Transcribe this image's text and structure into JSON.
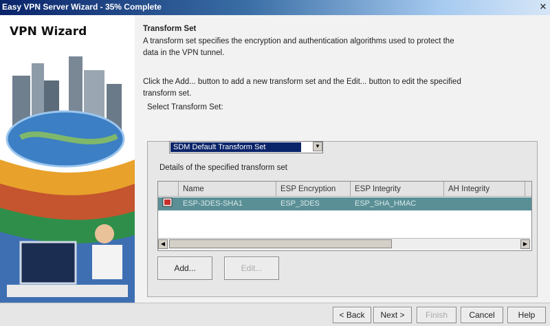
{
  "window": {
    "title": "Easy VPN Server Wizard - 35% Complete",
    "progress_percent": 35
  },
  "sidebar": {
    "heading": "VPN Wizard"
  },
  "section": {
    "title": "Transform Set",
    "description_line1": "A transform set specifies the encryption and authentication algorithms used to protect the",
    "description_line2": "data in the VPN tunnel.",
    "instruction_line1": "Click the Add... button to add a new transform set and the Edit... button to edit the specified",
    "instruction_line2": "transform set.",
    "select_label": "Select Transform Set:"
  },
  "transform_select": {
    "selected": "SDM Default Transform Set"
  },
  "details": {
    "label": "Details of the specified transform set",
    "columns": [
      "Name",
      "ESP Encryption",
      "ESP Integrity",
      "AH Integrity"
    ],
    "rows": [
      {
        "name": "ESP-3DES-SHA1",
        "esp_encryption": "ESP_3DES",
        "esp_integrity": "ESP_SHA_HMAC",
        "ah_integrity": ""
      }
    ]
  },
  "actions": {
    "add_label": "Add...",
    "edit_label": "Edit..."
  },
  "footer": {
    "back_label": "< Back",
    "next_label": "Next >",
    "finish_label": "Finish",
    "cancel_label": "Cancel",
    "help_label": "Help"
  },
  "colors": {
    "selection": "#0a246a",
    "row_selected": "#5a8f96",
    "title_gradient_start": "#0a246a"
  }
}
